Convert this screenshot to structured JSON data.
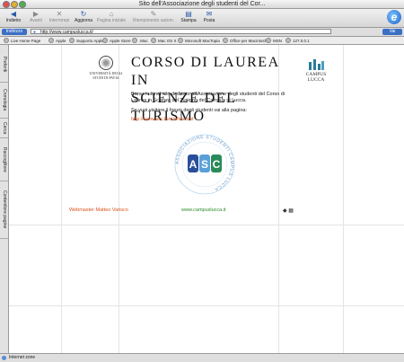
{
  "window": {
    "title": "Sito dell'Associazione degli studenti del Cor..."
  },
  "toolbar": {
    "buttons": [
      {
        "label": "Indietro",
        "icon": "back-arrow-icon",
        "glyph": "◀",
        "enabled": true
      },
      {
        "label": "Avanti",
        "icon": "forward-arrow-icon",
        "glyph": "▶",
        "enabled": false
      },
      {
        "label": "Interrompi",
        "icon": "stop-icon",
        "glyph": "✕",
        "enabled": false
      },
      {
        "label": "Aggiorna",
        "icon": "refresh-icon",
        "glyph": "↻",
        "enabled": true
      },
      {
        "label": "Pagina iniziale",
        "icon": "home-icon",
        "glyph": "⌂",
        "enabled": false
      },
      {
        "label": "Riempimento autom.",
        "icon": "autofill-icon",
        "glyph": "✎",
        "enabled": false
      },
      {
        "label": "Stampa",
        "icon": "print-icon",
        "glyph": "▤",
        "enabled": true
      },
      {
        "label": "Posta",
        "icon": "mail-icon",
        "glyph": "✉",
        "enabled": true
      }
    ],
    "browser_logo": "e"
  },
  "address": {
    "label": "Indirizzo",
    "url": "http://www.campuslucca.it/",
    "go_label": "Vai"
  },
  "favorites": [
    "Live Home Page",
    "Apple",
    "Supporto Apple",
    "Apple Store",
    ".Mac",
    "Mac OS X",
    "Microsoft MacTopia",
    "Office per Macintosh",
    "MSN",
    "127.0.0.1"
  ],
  "side_tabs": [
    "Preferiti",
    "Cronologia",
    "Cerca",
    "Raccoglitore",
    "Contenitore pagine"
  ],
  "page": {
    "unipv_logo_text": "UNIVERSITÀ DEGLI STUDI DI PAVIA",
    "title_line1": "CORSO DI LAUREA IN",
    "title_line2": "SCIENZE DEL TURISMO",
    "lucca_logo_text": "CAMPUS LUCCA",
    "intro": "Benvenuti nel sito dedicato all'Associazione degli studenti del Corso di Laurea in Scienze del Turismo del Campus di Lucca.",
    "visit": "Se vuoi visitare il forum degli studenti vai alla pagina:",
    "forum_link": "http://www.asc.forumfree.net",
    "asc_ring_text": "ASSOCIAZIONE STUDENTI CAMPUS LUCCA",
    "webmaster": "Webmaster Matteo Varisco",
    "website": "www.campuslucca.it"
  },
  "status": {
    "text": "Internet zone"
  },
  "colors": {
    "link_orange": "#d9531e",
    "link_green": "#2a8a2a",
    "ie_blue": "#1a62c9"
  }
}
